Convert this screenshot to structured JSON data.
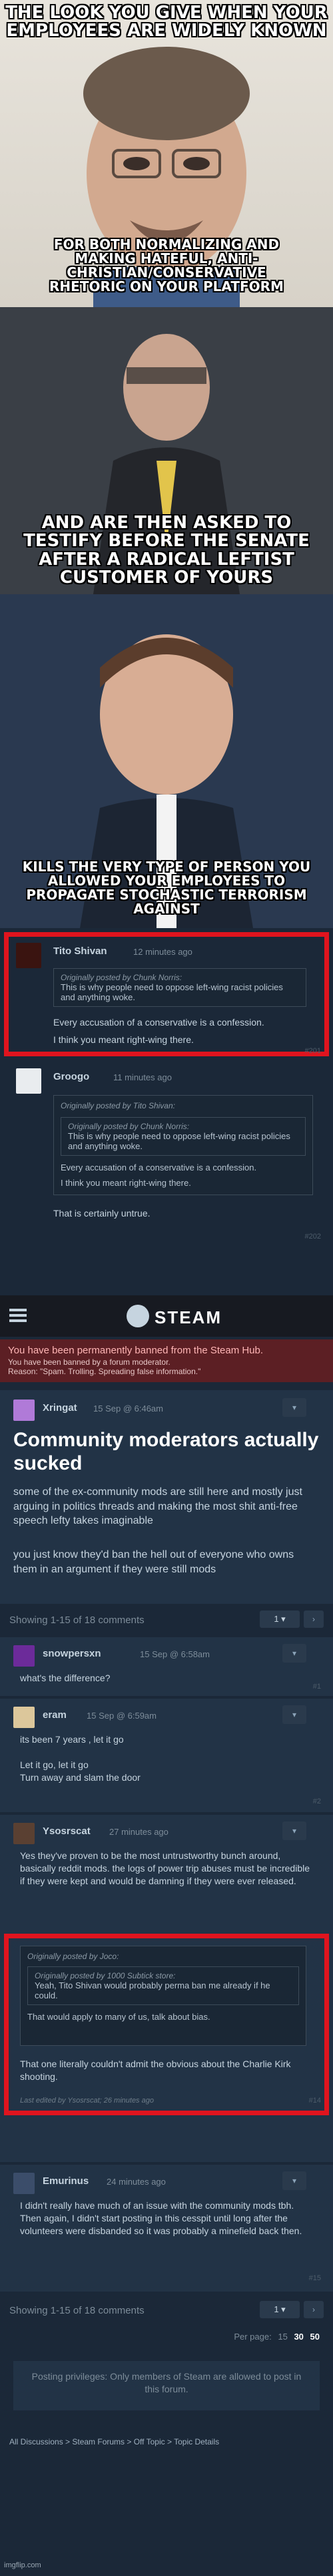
{
  "meme": {
    "panel1_top": "THE LOOK YOU GIVE WHEN YOUR EMPLOYEES ARE WIDELY KNOWN",
    "panel1_bottom": "FOR BOTH NORMALIZING AND MAKING HATEFUL, ANTI-CHRISTIAN/CONSERVATIVE RHETORIC ON YOUR PLATFORM",
    "panel2": "AND ARE THEN ASKED TO TESTIFY BEFORE THE SENATE AFTER A RADICAL LEFTIST CUSTOMER OF YOURS",
    "panel3": "KILLS THE VERY TYPE OF PERSON YOU ALLOWED YOUR EMPLOYEES TO PROPAGATE STOCHASTIC TERRORISM AGAINST"
  },
  "thread1": {
    "c1": {
      "user": "Tito Shivan",
      "time": "12 minutes ago",
      "quote_header": "Originally posted by Chunk Norris:",
      "quote": "This is why people need to oppose left-wing racist policies and anything woke.",
      "line1": "Every accusation of a conservative is a confession.",
      "line2": "I think you meant right-wing there.",
      "num": "#201"
    },
    "c2": {
      "user": "Groogo",
      "time": "11 minutes ago",
      "quote_header": "Originally posted by Tito Shivan:",
      "inner_header": "Originally posted by Chunk Norris:",
      "inner_quote": "This is why people need to oppose left-wing racist policies and anything woke.",
      "line1": "Every accusation of a conservative is a confession.",
      "line2": "I think you meant right-wing there.",
      "body": "That is certainly untrue.",
      "num": "#202"
    }
  },
  "steam": {
    "logo": "STEAM",
    "ban_title": "You have been permanently banned from the Steam Hub.",
    "ban_sub": "You have been banned by a forum moderator.",
    "ban_reason": "Reason: \"Spam. Trolling. Spreading false information.\"",
    "op_user": "Xringat",
    "op_time": "15 Sep @ 6:46am",
    "op_title": "Community moderators actually sucked",
    "op_p1": "some of the ex-community mods are still here and mostly just arguing in politics threads and making the most shit anti-free speech lefty takes imaginable",
    "op_p2": "you just know they'd ban the hell out of everyone who owns them in an argument if they were still mods",
    "showing": "Showing 1-15 of 18 comments",
    "page_sel": "1",
    "comments": [
      {
        "user": "snowpersxn",
        "time": "15 Sep @ 6:58am",
        "body": "what's the difference?",
        "num": "#1"
      },
      {
        "user": "eram",
        "time": "15 Sep @ 6:59am",
        "body": "its been 7 years , let it go\n\nLet it go, let it go\nTurn away and slam the door",
        "num": "#2"
      },
      {
        "user": "Ysosrscat",
        "time": "27 minutes ago",
        "body": "Yes they've proven to be the most untrustworthy bunch around, basically reddit mods. the logs of power trip abuses must be incredible if they were kept and would be damning if they were ever released.",
        "num": ""
      },
      {
        "user": "",
        "time": "",
        "quote_header": "Originally posted by Joco:",
        "inner_header": "Originally posted by 1000 Subtick store:",
        "inner_quote": "Yeah, Tito Shivan would probably perma ban me already if he could.",
        "quote": "That would apply to many of us, talk about bias.",
        "body": "That one literally couldn't admit the obvious about the Charlie Kirk shooting.",
        "edited": "Last edited by Ysosrscat; 26 minutes ago",
        "num": "#14"
      },
      {
        "user": "Emurinus",
        "time": "24 minutes ago",
        "body": "I didn't really have much of an issue with the community mods tbh. Then again, I didn't start posting in this cesspit until long after the volunteers were disbanded so it was probably a minefield back then.",
        "num": "#15"
      }
    ],
    "showing2": "Showing 1-15 of 18 comments",
    "per_page_label": "Per page:",
    "per_page": [
      "15",
      "30",
      "50"
    ],
    "privileges": "Posting privileges: Only members of Steam are allowed to post in this forum.",
    "breadcrumb": "All Discussions > Steam Forums > Off Topic > Topic Details",
    "watermark": "imgflip.com"
  },
  "colors": {
    "red": "#e0141e",
    "steam_bg": "#1b2838",
    "ban_bg": "#5c1f24"
  }
}
